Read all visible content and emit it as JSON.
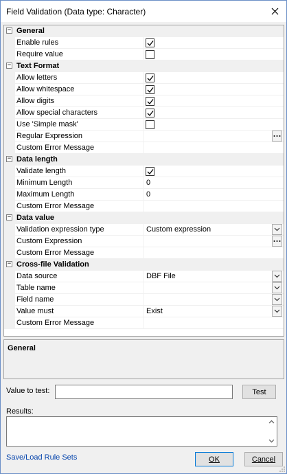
{
  "window": {
    "title": "Field Validation (Data type: Character)"
  },
  "colors": {
    "accent": "#0078d7",
    "link": "#0645ad",
    "grid_category_bg": "#f0f0f0"
  },
  "icons": {
    "close": "close-icon",
    "collapse": "minus-expander-icon",
    "check": "check-icon",
    "dropdown": "chevron-down-icon",
    "ellipsis": "ellipsis-icon"
  },
  "grid": {
    "rows": [
      {
        "type": "cat",
        "label": "General"
      },
      {
        "type": "prop",
        "name": "Enable rules",
        "kind": "check",
        "checked": true
      },
      {
        "type": "prop",
        "name": "Require value",
        "kind": "check",
        "checked": false
      },
      {
        "type": "cat",
        "label": "Text Format"
      },
      {
        "type": "prop",
        "name": "Allow letters",
        "kind": "check",
        "checked": true
      },
      {
        "type": "prop",
        "name": "Allow whitespace",
        "kind": "check",
        "checked": true
      },
      {
        "type": "prop",
        "name": "Allow digits",
        "kind": "check",
        "checked": true
      },
      {
        "type": "prop",
        "name": "Allow special characters",
        "kind": "check",
        "checked": true
      },
      {
        "type": "prop",
        "name": "Use 'Simple mask'",
        "kind": "check",
        "checked": false
      },
      {
        "type": "prop",
        "name": "Regular Expression",
        "kind": "ellipsis",
        "value": ""
      },
      {
        "type": "prop",
        "name": "Custom Error Message",
        "kind": "text",
        "value": ""
      },
      {
        "type": "cat",
        "label": "Data length"
      },
      {
        "type": "prop",
        "name": "Validate length",
        "kind": "check",
        "checked": true
      },
      {
        "type": "prop",
        "name": "Minimum Length",
        "kind": "text",
        "value": "0"
      },
      {
        "type": "prop",
        "name": "Maximum Length",
        "kind": "text",
        "value": "0"
      },
      {
        "type": "prop",
        "name": "Custom Error Message",
        "kind": "text",
        "value": ""
      },
      {
        "type": "cat",
        "label": "Data value"
      },
      {
        "type": "prop",
        "name": "Validation expression type",
        "kind": "dropdown",
        "value": "Custom expression"
      },
      {
        "type": "prop",
        "name": "Custom Expression",
        "kind": "ellipsis",
        "value": ""
      },
      {
        "type": "prop",
        "name": "Custom Error Message",
        "kind": "text",
        "value": ""
      },
      {
        "type": "cat",
        "label": "Cross-file Validation"
      },
      {
        "type": "prop",
        "name": "Data source",
        "kind": "dropdown",
        "value": "DBF File"
      },
      {
        "type": "prop",
        "name": "Table name",
        "kind": "dropdown",
        "value": ""
      },
      {
        "type": "prop",
        "name": "Field name",
        "kind": "dropdown",
        "value": ""
      },
      {
        "type": "prop",
        "name": "Value must",
        "kind": "dropdown",
        "value": "Exist"
      },
      {
        "type": "prop",
        "name": "Custom Error Message",
        "kind": "text",
        "value": ""
      }
    ]
  },
  "description": {
    "title": "General"
  },
  "test": {
    "label": "Value to test:",
    "value": "",
    "button": "Test"
  },
  "results": {
    "label": "Results:",
    "value": ""
  },
  "footer": {
    "link": "Save/Load Rule Sets",
    "ok": "OK",
    "cancel": "Cancel"
  }
}
